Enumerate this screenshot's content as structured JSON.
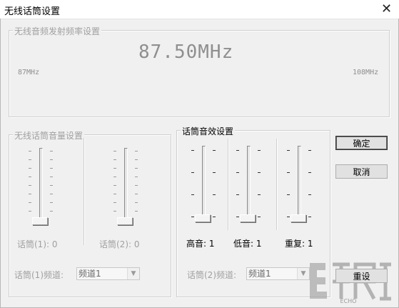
{
  "window": {
    "title": "无线话筒设置",
    "close_glyph": "✕"
  },
  "frequency": {
    "legend": "无线音频发射频率设置",
    "value": "87.50MHz",
    "min_label": "87MHz",
    "max_label": "108MHz"
  },
  "mic_volume": {
    "legend": "无线话筒音量设置",
    "mic1_label": "话筒(1): 0",
    "mic2_label": "话筒(2): 0",
    "mic1_level": 0,
    "mic2_level": 0,
    "channel1_label": "话筒(1)频道:",
    "channel1_value": "频道1"
  },
  "effects": {
    "legend": "话筒音效设置",
    "treble_label": "高音: 1",
    "bass_label": "低音: 1",
    "repeat_label": "重复: 1",
    "channel2_label": "话筒(2)频道:",
    "channel2_value": "频道1"
  },
  "buttons": {
    "ok": "确定",
    "cancel": "取消",
    "reset": "重设"
  },
  "watermark_text": "ECHO"
}
